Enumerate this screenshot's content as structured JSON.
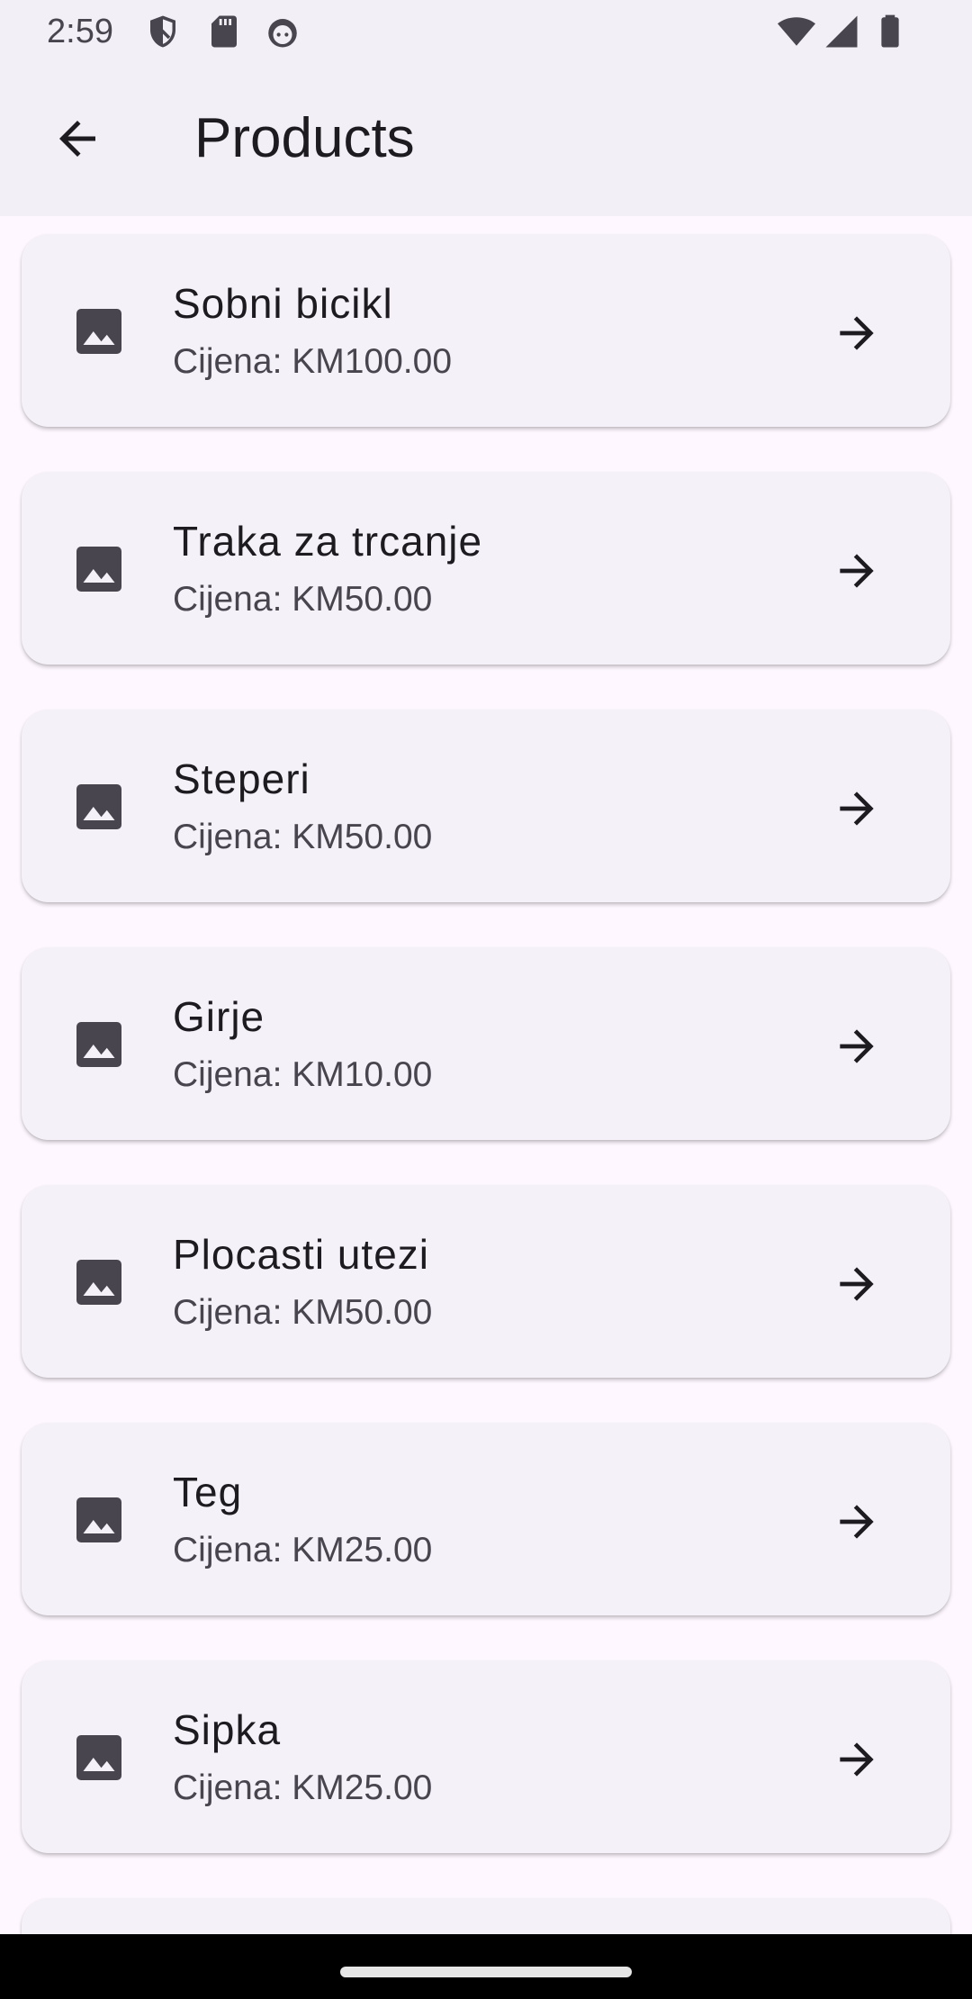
{
  "status_bar": {
    "time": "2:59",
    "left_icons": [
      "shield-icon",
      "sd-card-icon",
      "android-face-icon"
    ],
    "right_icons": [
      "wifi-icon",
      "signal-icon",
      "battery-icon"
    ]
  },
  "app_bar": {
    "title": "Products",
    "back_icon": "arrow-back-icon"
  },
  "products": [
    {
      "name": "Sobni bicikl",
      "price": "Cijena: KM100.00"
    },
    {
      "name": "Traka za trcanje",
      "price": "Cijena: KM50.00"
    },
    {
      "name": "Steperi",
      "price": "Cijena: KM50.00"
    },
    {
      "name": "Girje",
      "price": "Cijena: KM10.00"
    },
    {
      "name": "Plocasti utezi",
      "price": "Cijena: KM50.00"
    },
    {
      "name": "Teg",
      "price": "Cijena: KM25.00"
    },
    {
      "name": "Sipka",
      "price": "Cijena: KM25.00"
    }
  ],
  "colors": {
    "background": "#FEF7FF",
    "app_bar": "#F2EFF6",
    "card": "#F5F1F8",
    "text_primary": "#1D1B20",
    "text_secondary": "#49454F"
  }
}
